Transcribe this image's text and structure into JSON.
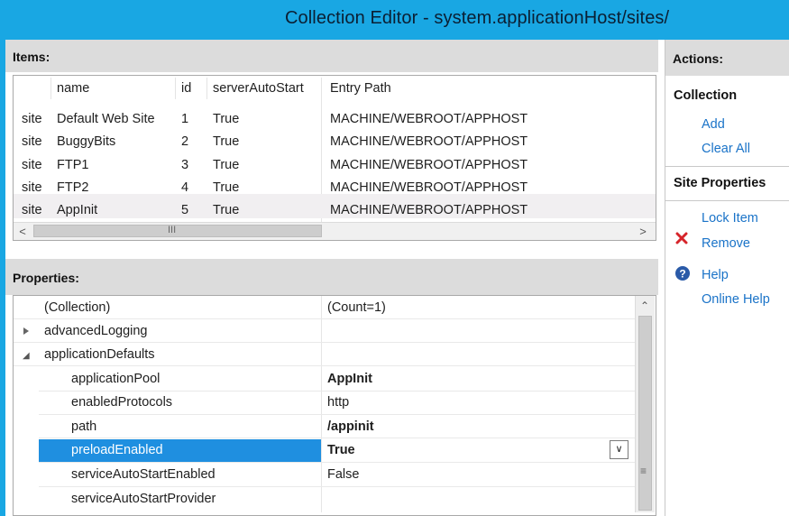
{
  "window": {
    "title": "Collection Editor - system.applicationHost/sites/"
  },
  "items": {
    "header": "Items:",
    "columns": [
      "name",
      "id",
      "serverAutoStart",
      "Entry Path"
    ],
    "rows": [
      {
        "type": "site",
        "name": "Default Web Site",
        "id": "1",
        "serverAutoStart": "True",
        "entry_path": "MACHINE/WEBROOT/APPHOST"
      },
      {
        "type": "site",
        "name": "BuggyBits",
        "id": "2",
        "serverAutoStart": "True",
        "entry_path": "MACHINE/WEBROOT/APPHOST"
      },
      {
        "type": "site",
        "name": "FTP1",
        "id": "3",
        "serverAutoStart": "True",
        "entry_path": "MACHINE/WEBROOT/APPHOST"
      },
      {
        "type": "site",
        "name": "FTP2",
        "id": "4",
        "serverAutoStart": "True",
        "entry_path": "MACHINE/WEBROOT/APPHOST"
      },
      {
        "type": "site",
        "name": "AppInit",
        "id": "5",
        "serverAutoStart": "True",
        "entry_path": "MACHINE/WEBROOT/APPHOST"
      }
    ],
    "selected_row": 4,
    "scroll_left_glyph": "<",
    "scroll_right_glyph": ">",
    "scroll_grip": "III"
  },
  "properties": {
    "header": "Properties:",
    "rows": [
      {
        "name": "(Collection)",
        "value": "(Count=1)",
        "indent": 0,
        "expander": ""
      },
      {
        "name": "advancedLogging",
        "value": "",
        "indent": 0,
        "expander": "collapsed"
      },
      {
        "name": "applicationDefaults",
        "value": "",
        "indent": 0,
        "expander": "expanded"
      },
      {
        "name": "applicationPool",
        "value": "AppInit",
        "indent": 1,
        "bold": true
      },
      {
        "name": "enabledProtocols",
        "value": "http",
        "indent": 1
      },
      {
        "name": "path",
        "value": "/appinit",
        "indent": 1,
        "bold": true
      },
      {
        "name": "preloadEnabled",
        "value": "True",
        "indent": 1,
        "bold": true,
        "selected": true
      },
      {
        "name": "serviceAutoStartEnabled",
        "value": "False",
        "indent": 1
      },
      {
        "name": "serviceAutoStartProvider",
        "value": "",
        "indent": 1
      }
    ],
    "dropdown_glyph": "v",
    "scroll_up_glyph": "^",
    "scroll_grip": "≡"
  },
  "actions": {
    "header": "Actions:",
    "groups": [
      {
        "title": "Collection",
        "links": [
          "Add",
          "Clear All"
        ]
      },
      {
        "title": "Site Properties",
        "links": [
          "Lock Item",
          "Remove",
          "Help",
          "Online Help"
        ]
      }
    ]
  },
  "colors": {
    "title_bar": "#19a7e3",
    "selection": "#1f8fe0",
    "link": "#1a73c8",
    "remove_icon": "#d6242a",
    "help_icon": "#2a5aa8"
  }
}
